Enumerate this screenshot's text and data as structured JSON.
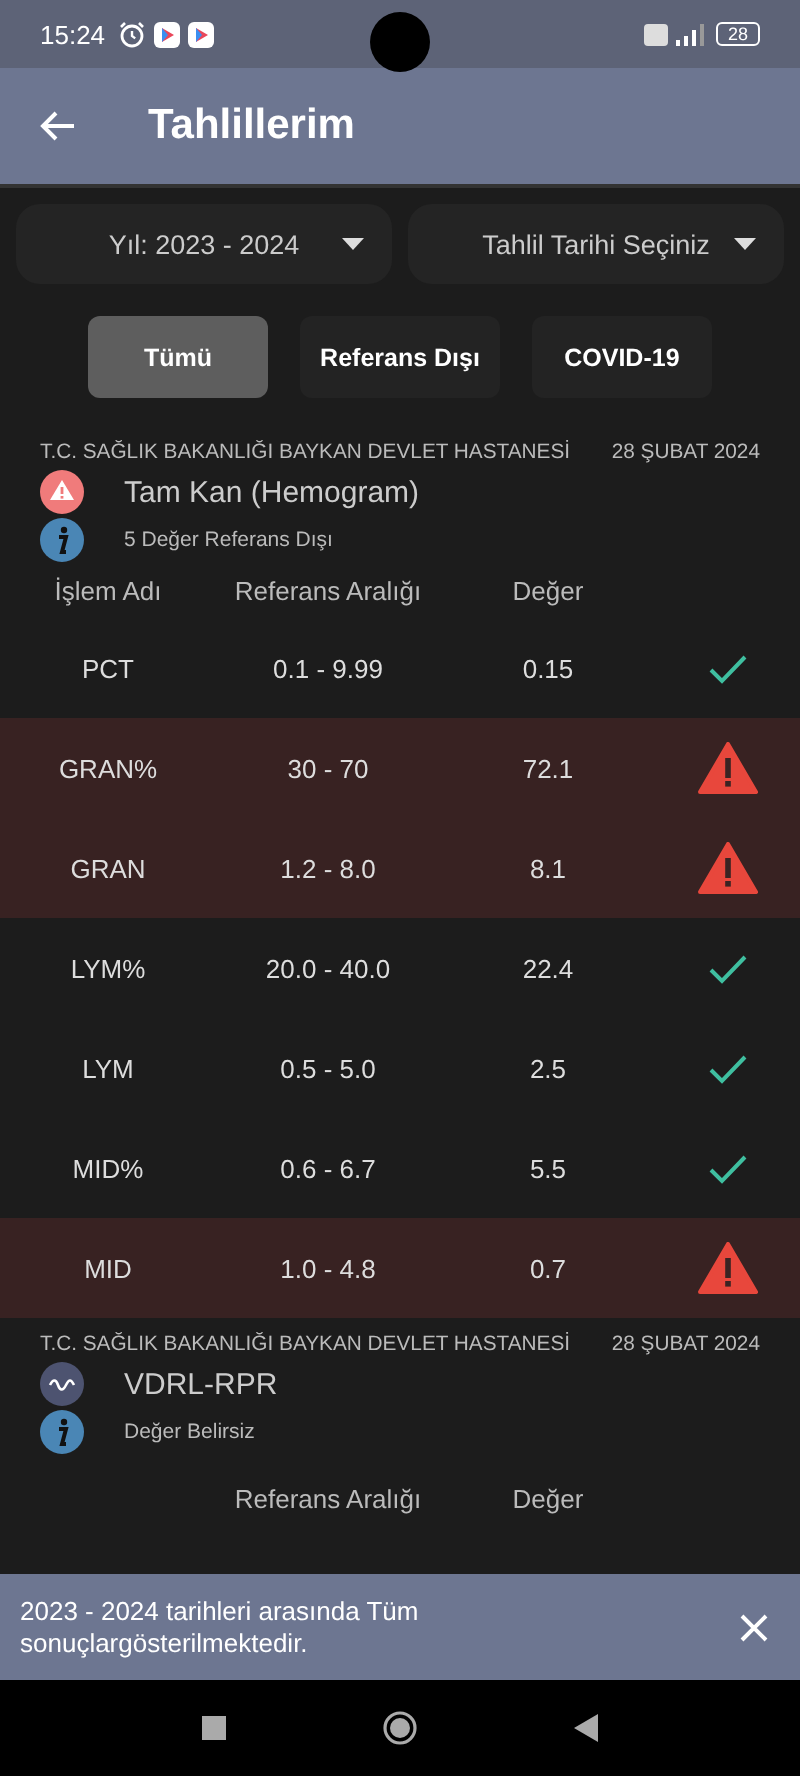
{
  "status_bar": {
    "time": "15:24",
    "battery": "28"
  },
  "app_bar": {
    "title": "Tahlillerim"
  },
  "filters": [
    {
      "label": "Yıl: 2023 - 2024"
    },
    {
      "label": "Tahlil Tarihi Seçiniz"
    }
  ],
  "chips": [
    {
      "label": "Tümü",
      "selected": true
    },
    {
      "label": "Referans Dışı",
      "selected": false
    },
    {
      "label": "COVID-19",
      "selected": false
    }
  ],
  "results": [
    {
      "hospital": "T.C. SAĞLIK BAKANLIĞI BAYKAN DEVLET HASTANESİ",
      "date": "28 ŞUBAT 2024",
      "kind": "warning",
      "title": "Tam Kan (Hemogram)",
      "subtitle": "5 Değer Referans Dışı",
      "columns": [
        "İşlem Adı",
        "Referans Aralığı",
        "Değer"
      ],
      "rows": [
        {
          "name": "PCT",
          "range": "0.1 - 9.99",
          "value": "0.15",
          "out_of_range": false
        },
        {
          "name": "GRAN%",
          "range": "30 - 70",
          "value": "72.1",
          "out_of_range": true
        },
        {
          "name": "GRAN",
          "range": "1.2 - 8.0",
          "value": "8.1",
          "out_of_range": true
        },
        {
          "name": "LYM%",
          "range": "20.0 - 40.0",
          "value": "22.4",
          "out_of_range": false
        },
        {
          "name": "LYM",
          "range": "0.5 - 5.0",
          "value": "2.5",
          "out_of_range": false
        },
        {
          "name": "MID%",
          "range": "0.6 - 6.7",
          "value": "5.5",
          "out_of_range": false
        },
        {
          "name": "MID",
          "range": "1.0 - 4.8",
          "value": "0.7",
          "out_of_range": true
        }
      ]
    },
    {
      "hospital": "T.C. SAĞLIK BAKANLIĞI BAYKAN DEVLET HASTANESİ",
      "date": "28 ŞUBAT 2024",
      "kind": "unknown",
      "title": "VDRL-RPR",
      "subtitle": "Değer Belirsiz",
      "columns": [
        "Referans Aralığı",
        "Değer"
      ]
    }
  ],
  "snackbar": {
    "message": "2023 - 2024 tarihleri arasında Tüm sonuçlargösterilmektedir."
  }
}
